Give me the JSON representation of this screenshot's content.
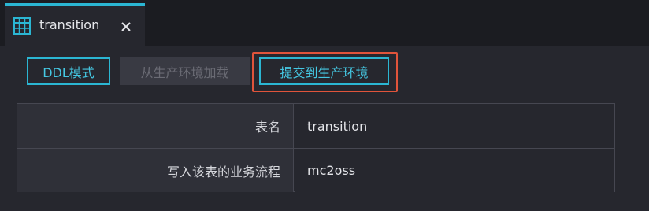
{
  "tab": {
    "label": "transition",
    "icon": "table-grid-icon",
    "close_icon": "close-icon"
  },
  "toolbar": {
    "ddl_mode_label": "DDL模式",
    "load_from_production_label": "从生产环境加载",
    "submit_to_production_label": "提交到生产环境"
  },
  "table": {
    "rows": [
      {
        "key": "表名",
        "value": "transition"
      },
      {
        "key": "写入该表的业务流程",
        "value": "mc2oss"
      }
    ]
  },
  "colors": {
    "accent": "#2bb6d3",
    "highlight": "#e0543b",
    "background": "#26272e"
  }
}
